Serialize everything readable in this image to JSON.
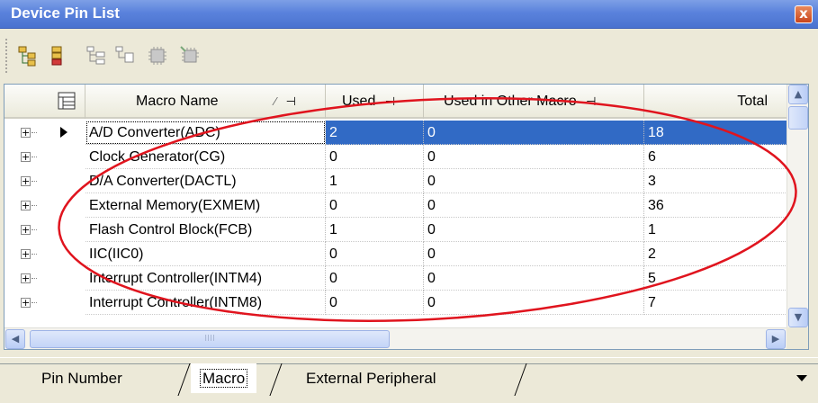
{
  "window": {
    "title": "Device Pin List",
    "close_glyph": "x"
  },
  "toolbar": {
    "buttons": [
      {
        "icon": "expand-tree-icon"
      },
      {
        "icon": "collapse-tree-icon"
      },
      {
        "icon": "tree-view-icon"
      },
      {
        "icon": "tree-detail-icon"
      },
      {
        "icon": "chip-icon"
      },
      {
        "icon": "chip-all-icon"
      }
    ]
  },
  "grid": {
    "columns": {
      "name": "Macro Name",
      "used": "Used",
      "other": "Used in Other Macro",
      "total": "Total",
      "sort_glyph": "⁄",
      "pin_glyph": "⊣"
    },
    "rows": [
      {
        "name": "A/D Converter(ADC)",
        "used": "2",
        "other": "0",
        "total": "18",
        "selected": true
      },
      {
        "name": "Clock Generator(CG)",
        "used": "0",
        "other": "0",
        "total": "6"
      },
      {
        "name": "D/A Converter(DACTL)",
        "used": "1",
        "other": "0",
        "total": "3"
      },
      {
        "name": "External Memory(EXMEM)",
        "used": "0",
        "other": "0",
        "total": "36"
      },
      {
        "name": "Flash Control Block(FCB)",
        "used": "1",
        "other": "0",
        "total": "1"
      },
      {
        "name": "IIC(IIC0)",
        "used": "0",
        "other": "0",
        "total": "2"
      },
      {
        "name": "Interrupt Controller(INTM4)",
        "used": "0",
        "other": "0",
        "total": "5"
      },
      {
        "name": "Interrupt Controller(INTM8)",
        "used": "0",
        "other": "0",
        "total": "7"
      }
    ],
    "expand_glyph": "+"
  },
  "scroll": {
    "up": "▲",
    "down": "▼",
    "left": "◀",
    "right": "▶",
    "grip": "IIII"
  },
  "tabs": [
    {
      "label": "Pin Number",
      "active": false
    },
    {
      "label": "Macro",
      "active": true
    },
    {
      "label": "External Peripheral",
      "active": false
    }
  ],
  "colors": {
    "selection": "#316ac5",
    "annotation": "#e0141e",
    "titlebar": "#5a82dc"
  }
}
